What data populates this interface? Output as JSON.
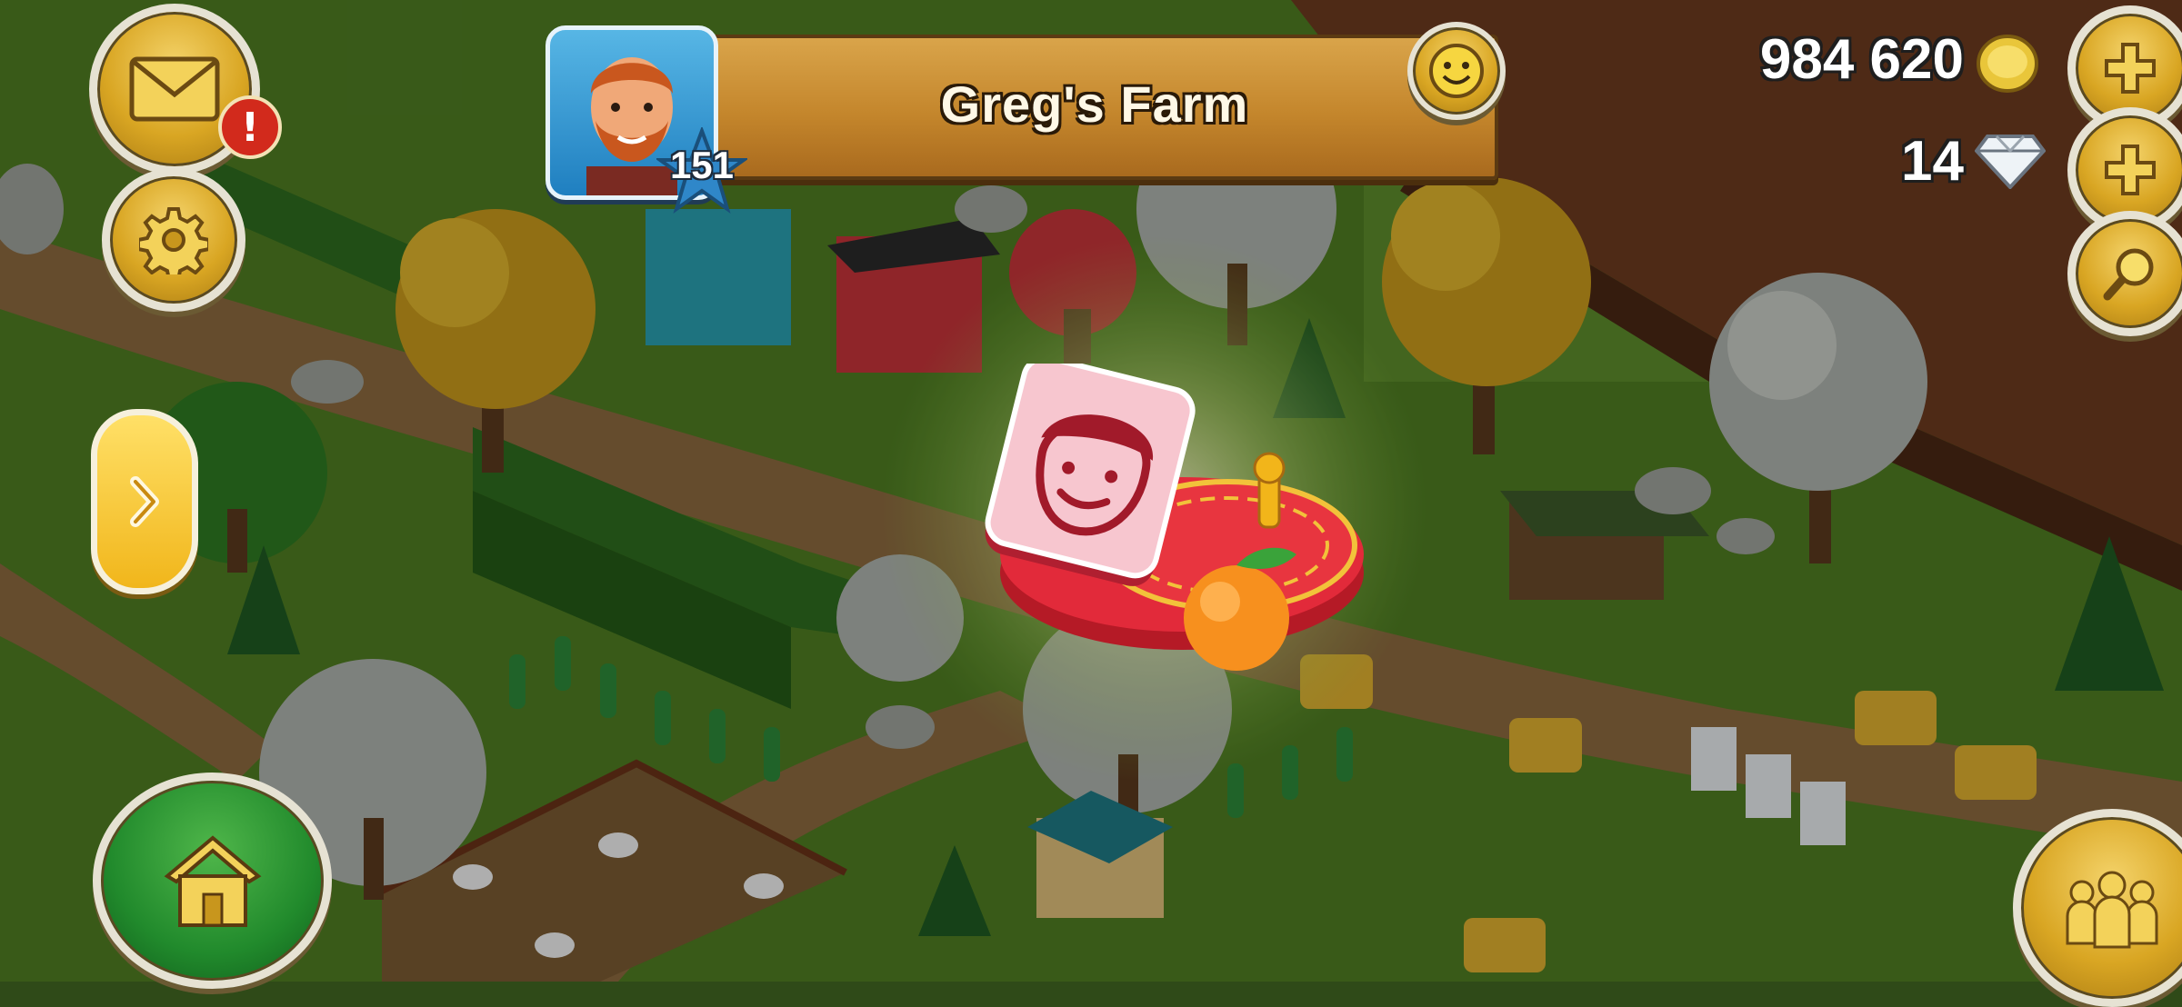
{
  "farm": {
    "name": "Greg's Farm",
    "level": "151"
  },
  "currency": {
    "coins": "984 620",
    "gems": "14"
  },
  "hud": {
    "mail_alert": "!",
    "icons": {
      "mail": "envelope-icon",
      "settings": "gear-icon",
      "home": "home-icon",
      "friends": "friends-icon",
      "add_coins": "plus-icon",
      "add_gems": "plus-icon",
      "search": "magnifier-icon",
      "smiley": "smiley-icon",
      "side_arrow": "chevron-right-icon"
    }
  },
  "colors": {
    "hud_gold": "#d9a623",
    "banner_wood": "#c4862c",
    "home_green": "#218a2c",
    "reward_red": "#e22a3a"
  }
}
